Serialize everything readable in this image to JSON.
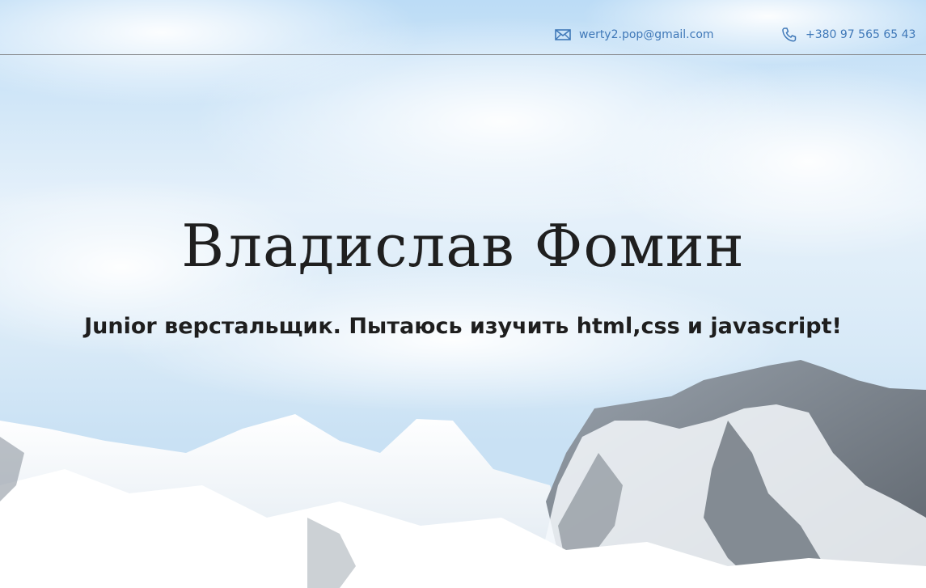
{
  "header": {
    "email": {
      "text": "werty2.pop@gmail.com",
      "icon": "envelope-icon"
    },
    "phone": {
      "text": "+380 97 565 65 43",
      "icon": "phone-icon"
    }
  },
  "hero": {
    "title": "Владислав Фомин",
    "subtitle": "Junior верстальщик. Пытаюсь изучить html,css и javascript!",
    "background": "snowy-mountains-image"
  },
  "colors": {
    "accent": "#3f78b8",
    "text": "#1f1f1f",
    "divider": "#8c8f93"
  }
}
